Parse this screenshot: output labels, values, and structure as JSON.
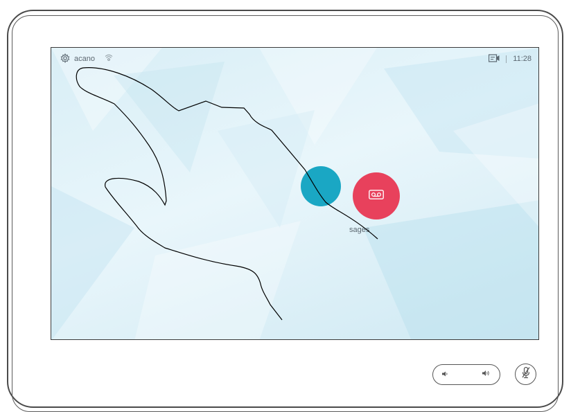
{
  "status_bar": {
    "device_name": "acano",
    "time": "11:28"
  },
  "actions": {
    "voicemail_label": "sages"
  },
  "colors": {
    "voicemail": "#e8415c",
    "call": "#1aa7c4",
    "screen_bg": "#dff1f8"
  },
  "icons": {
    "settings": "gear-icon",
    "proximity": "proximity-icon",
    "self_view": "self-view-icon",
    "voicemail": "voicemail-icon",
    "volume_down": "speaker-low-icon",
    "volume_up": "speaker-high-icon",
    "mute": "microphone-muted-icon"
  }
}
